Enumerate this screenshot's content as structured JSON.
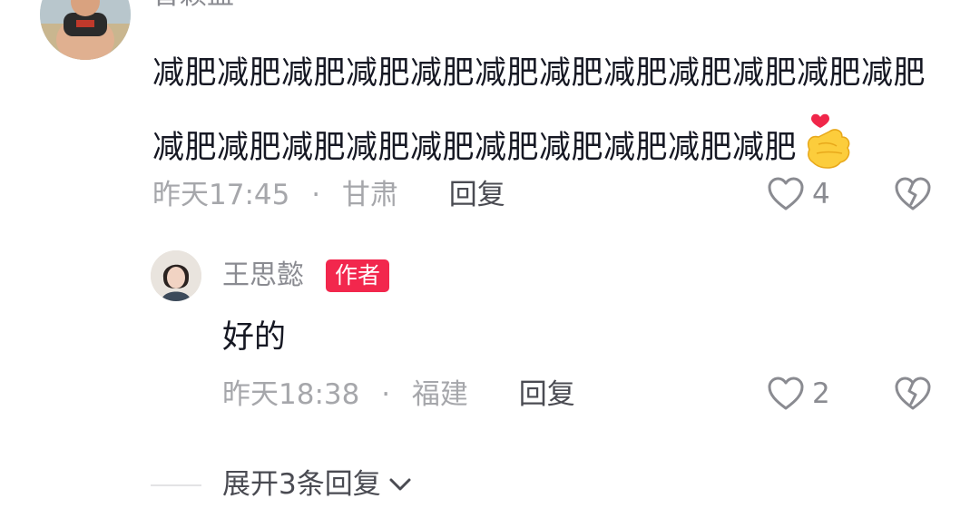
{
  "comment": {
    "username": "曾颖盈",
    "text": "减肥减肥减肥减肥减肥减肥减肥减肥减肥减肥减肥减肥减肥减肥减肥减肥减肥减肥减肥减肥减肥减肥",
    "emoji": "finger-heart-emoji",
    "time": "昨天17:45",
    "separator": "·",
    "location": "甘肃",
    "reply_label": "回复",
    "like_count": "4"
  },
  "reply": {
    "username": "王思懿",
    "badge": "作者",
    "text": "好的",
    "time": "昨天18:38",
    "separator": "·",
    "location": "福建",
    "reply_label": "回复",
    "like_count": "2"
  },
  "expand": {
    "label": "展开3条回复"
  },
  "icons": {
    "like": "heart-outline-icon",
    "dislike": "broken-heart-icon",
    "expand": "chevron-down-icon"
  },
  "colors": {
    "badge": "#f2274d",
    "text": "#161823",
    "secondary": "#a6a7ab",
    "reply_link": "#4a4b52"
  }
}
